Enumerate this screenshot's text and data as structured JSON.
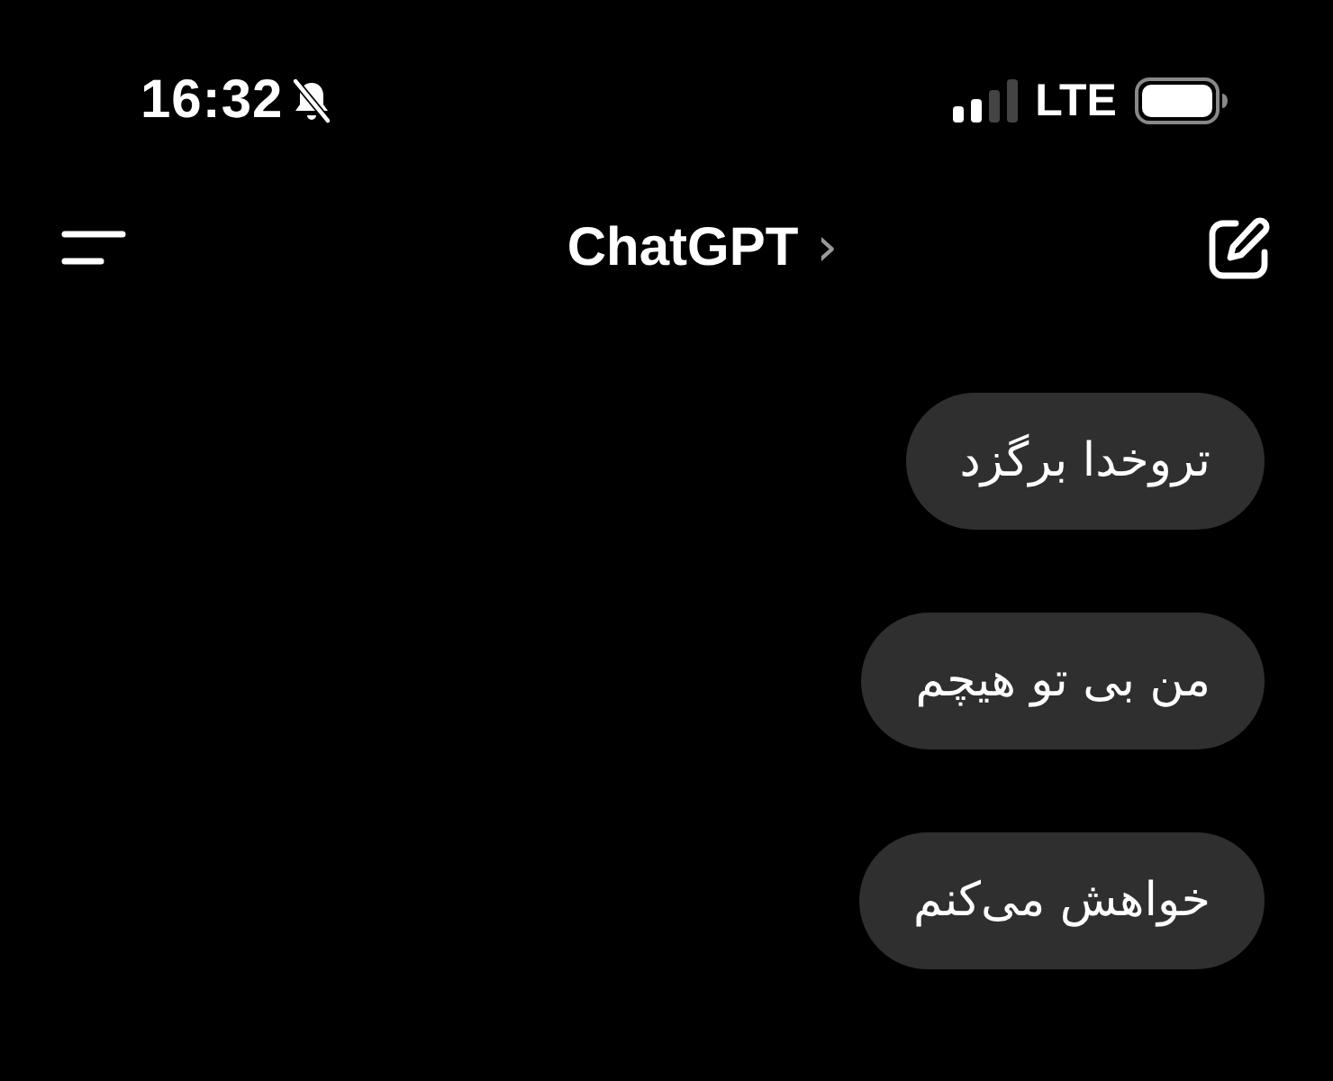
{
  "status_bar": {
    "time": "16:32",
    "network": "LTE"
  },
  "header": {
    "title": "ChatGPT",
    "chevron": "›"
  },
  "messages": [
    {
      "text": "تروخدا برگزد"
    },
    {
      "text": "من بی تو هیچم"
    },
    {
      "text": "خواهش می‌کنم"
    }
  ]
}
